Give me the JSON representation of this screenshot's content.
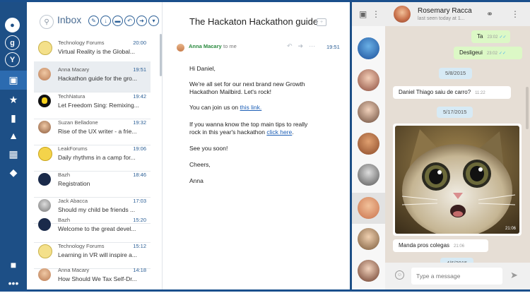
{
  "inbox": {
    "title": "Inbox",
    "messages": [
      {
        "sender": "Technology Forums",
        "time": "20:00",
        "subject": "Virtual Reality is the Global..."
      },
      {
        "sender": "Anna Macary",
        "time": "19:51",
        "subject": "Hackathon guide for the gro..."
      },
      {
        "sender": "TechNatura",
        "time": "19:42",
        "subject": "Let Freedom Sing: Remixing..."
      },
      {
        "sender": "Suzan Belladone",
        "time": "19:32",
        "subject": "Rise of the UX writer - a frie..."
      },
      {
        "sender": "LeakForums",
        "time": "19:06",
        "subject": "Daily rhythms in a camp for..."
      },
      {
        "sender": "Bazh",
        "time": "18:46",
        "subject": "Registration"
      },
      {
        "sender": "Jack Abacca",
        "time": "17:03",
        "subject": "Should my child be friends ..."
      },
      {
        "sender": "Bazh",
        "time": "15:20",
        "subject": "Welcome to the great devel..."
      },
      {
        "sender": "Technology Forums",
        "time": "15:12",
        "subject": "Learning in VR will inspire a..."
      },
      {
        "sender": "Anna Macary",
        "time": "14:18",
        "subject": "How Should We Tax Self-Dr..."
      }
    ]
  },
  "reader": {
    "title": "The Hackaton Hackathon guide",
    "from": "Anna Macary",
    "to": "to me",
    "time": "19:51",
    "greeting": "Hi Daniel,",
    "p1a": "We're all set for our next brand new Growth",
    "p1b": "Hackathon Mailbird. Let's rock!",
    "p2": "You can join us on ",
    "link1": "this link.",
    "p3a": "If you wanna know the top main tips to really",
    "p3b": "rock in this year's hackathon ",
    "link2": "click here",
    "p3end": ".",
    "p4": "See you soon!",
    "p5": "Cheers,",
    "p6": "Anna"
  },
  "chat": {
    "name": "Rosemary Racca",
    "status": "last seen today at 1...",
    "messages": {
      "m1": {
        "text": "Ta",
        "time": "23:02"
      },
      "m2": {
        "text": "Desligeui",
        "time": "23:02"
      },
      "d1": "5/8/2015",
      "m3": {
        "text": "Daniel Thiago saiu de carro?",
        "time": "11:22"
      },
      "d2": "5/17/2015",
      "photo_time": "21:06",
      "m4": {
        "text": "Manda pros colegas",
        "time": "21:06"
      },
      "d3": "4/6/2015"
    },
    "input_placeholder": "Type a message"
  }
}
